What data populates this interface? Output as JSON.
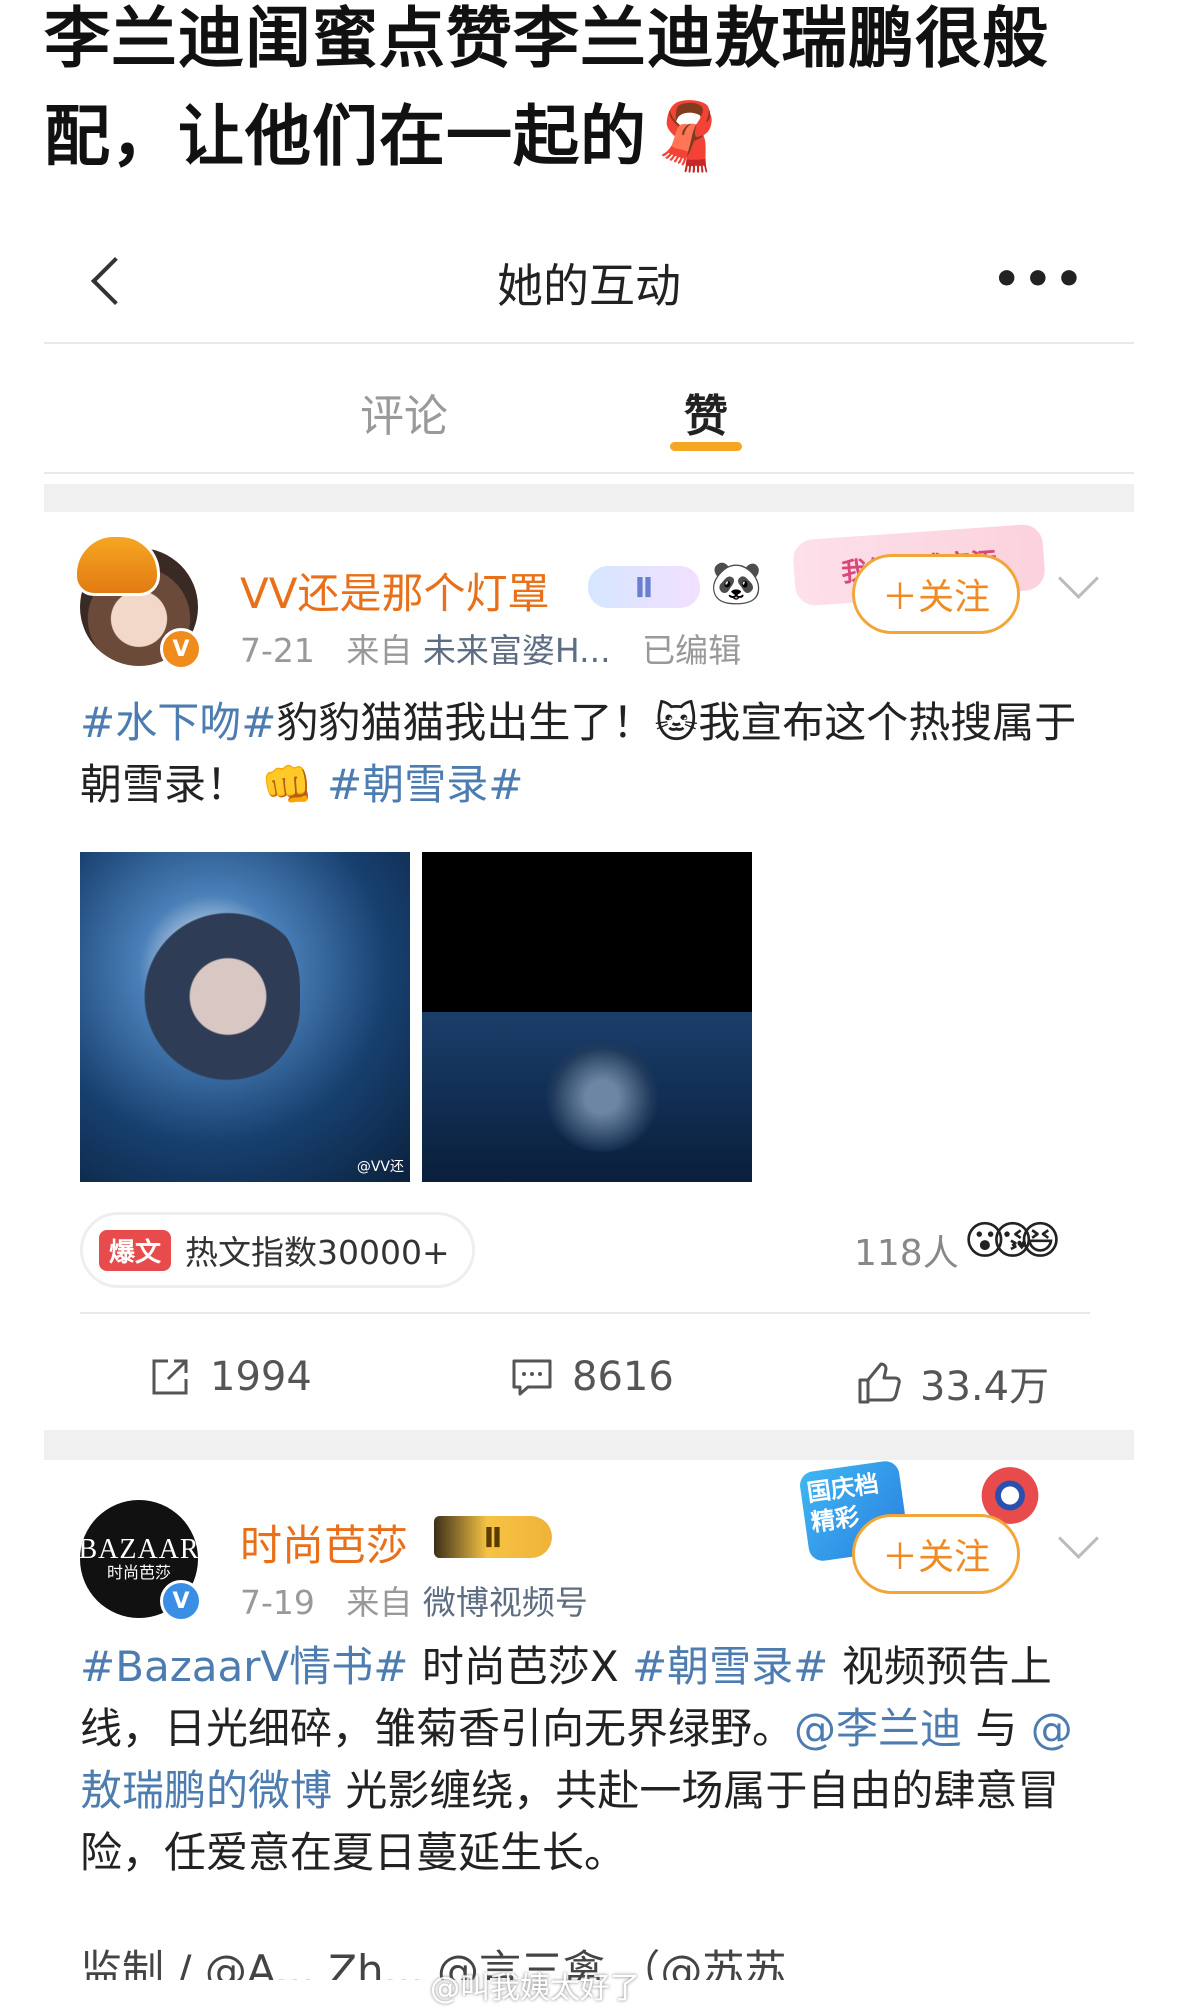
{
  "headline": {
    "line1": "李兰迪闺蜜点赞李兰迪敖瑞鹏很般",
    "line2": "配，让他们在一起的",
    "emoji": "🧣"
  },
  "navbar": {
    "title": "她的互动",
    "back_icon": "back-chevron-icon",
    "more_icon": "more-dots-icon",
    "more_label": "•••"
  },
  "tabs": [
    {
      "label": "评论",
      "active": false
    },
    {
      "label": "赞",
      "active": true
    }
  ],
  "post1": {
    "username": "VV还是那个灯罩",
    "badge_label": "Ⅱ",
    "panda": "🐼",
    "decor_text": "我们终成宫添",
    "date": "7-21",
    "source_prefix": "来自",
    "source": "未来富婆H...",
    "edited": "已编辑",
    "follow_label": "＋关注",
    "text": {
      "tag1": "#水下吻#",
      "seg1": "豹豹猫猫我出生了！",
      "cat": "🐱",
      "seg2": "我宣布这个热搜属于朝雪录！",
      "fist": "👊",
      "tag2": "#朝雪录#"
    },
    "image_watermark": "@VV还",
    "hot_label": "爆文",
    "hot_text": "热文指数30000+",
    "reactions_count": "118人",
    "reaction_emojis": [
      "😮",
      "😘",
      "😆"
    ],
    "reposts": "1994",
    "comments": "8616",
    "likes": "33.4万"
  },
  "post2": {
    "avatar_text_top": "BAZAAR",
    "avatar_text_bottom": "时尚芭莎",
    "username": "时尚芭莎",
    "badge_label": "Ⅱ",
    "decor_text": "国庆档 精彩",
    "date": "7-19",
    "source_prefix": "来自",
    "source": "微博视频号",
    "follow_label": "＋关注",
    "text": {
      "tag1": "#BazaarV情书#",
      "seg1": " 时尚芭莎X ",
      "tag2": "#朝雪录#",
      "seg2": " 视频预告上线，日光细碎，雏菊香引向无界绿野。",
      "mention1": "@李兰迪",
      "seg3": " 与 ",
      "mention2": "@敖瑞鹏的微博",
      "seg4": " 光影缠绕，共赴一场属于自由的肆意冒险，任爱意在夏日蔓延生长。"
    },
    "cut_line": "监制 / @A... Zh... @言三禽 （@苏苏"
  },
  "watermark": "@叫我姨太好了",
  "colors": {
    "accent": "#f5a623",
    "link": "#4d7cb0",
    "username": "#e8701a",
    "follow": "#f08b24"
  }
}
